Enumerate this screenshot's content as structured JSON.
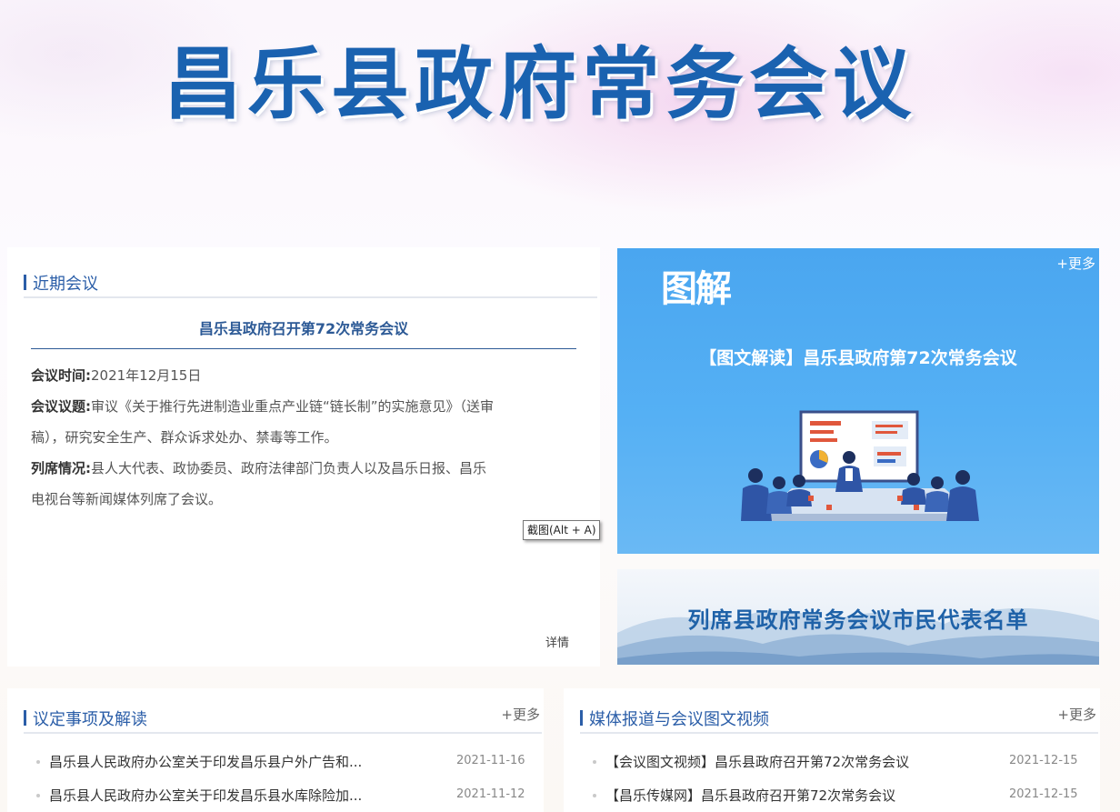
{
  "banner": {
    "title": "昌乐县政府常务会议"
  },
  "recent": {
    "heading": "近期会议",
    "meeting_title": "昌乐县政府召开第72次常务会议",
    "time_label": "会议时间:",
    "time_value": "2021年12月15日",
    "topic_label": "会议议题:",
    "topic_line1": "审议《关于推行先进制造业重点产业链“链长制”的实施意见》（送审",
    "topic_line2": "稿），研究安全生产、群众诉求处办、禁毒等工作。",
    "attend_label": "列席情况:",
    "attend_line1": "县人大代表、政协委员、政府法律部门负责人以及昌乐日报、昌乐",
    "attend_line2": "电视台等新闻媒体列席了会议。",
    "detail": "详情"
  },
  "tooltip": {
    "text": "截图(Alt + A)"
  },
  "tujie": {
    "logo": "图解",
    "more": "+更多",
    "caption": "【图文解读】昌乐县政府第72次常务会议"
  },
  "reps": {
    "title": "列席县政府常务会议市民代表名单"
  },
  "decisions": {
    "heading": "议定事项及解读",
    "more": "+更多",
    "items": [
      {
        "title": "昌乐县人民政府办公室关于印发昌乐县户外广告和...",
        "date": "2021-11-16"
      },
      {
        "title": "昌乐县人民政府办公室关于印发昌乐县水库除险加...",
        "date": "2021-11-12"
      }
    ]
  },
  "media": {
    "heading": "媒体报道与会议图文视频",
    "more": "+更多",
    "items": [
      {
        "title": "【会议图文视频】昌乐县政府召开第72次常务会议",
        "date": "2021-12-15"
      },
      {
        "title": "【昌乐传媒网】昌乐县政府召开第72次常务会议",
        "date": "2021-12-15"
      }
    ]
  },
  "colors": {
    "accent": "#2b5ea8",
    "banner_blue": "#1a62b0",
    "card_blue": "#4aa6f0"
  }
}
